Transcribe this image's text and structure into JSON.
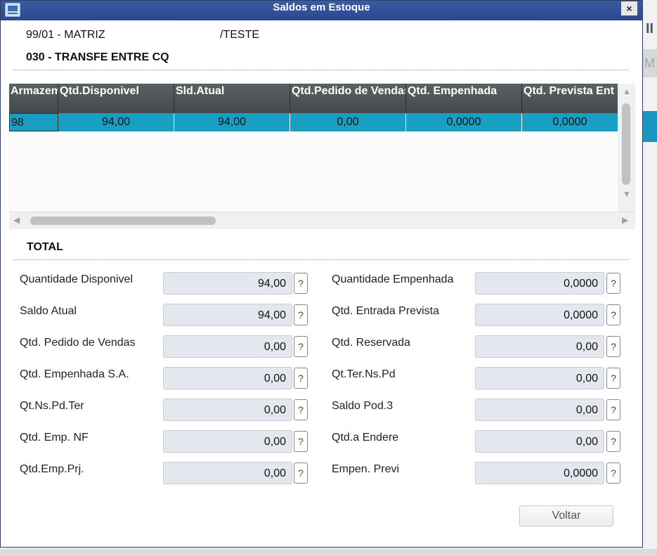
{
  "window": {
    "title": "Saldos em Estoque",
    "close_glyph": "×"
  },
  "background": {
    "right_top": "II",
    "right_mid": "M"
  },
  "header": {
    "branch": "99/01 - MATRIZ",
    "branch_suffix": "/TESTE",
    "product": "030 - TRANSFE ENTRE CQ"
  },
  "grid": {
    "columns": [
      "Armazem",
      "Qtd.Disponivel",
      "Sld.Atual",
      "Qtd.Pedido de Vendas",
      "Qtd. Empenhada",
      "Qtd. Prevista Ent"
    ],
    "rows": [
      [
        "98",
        "94,00",
        "94,00",
        "0,00",
        "0,0000",
        "0,0000"
      ]
    ]
  },
  "total": {
    "label": "TOTAL",
    "help_glyph": "?",
    "left": [
      {
        "label": "Quantidade Disponivel",
        "value": "94,00"
      },
      {
        "label": "Saldo Atual",
        "value": "94,00"
      },
      {
        "label": "Qtd. Pedido de Vendas",
        "value": "0,00"
      },
      {
        "label": "Qtd. Empenhada S.A.",
        "value": "0,00"
      },
      {
        "label": "Qt.Ns.Pd.Ter",
        "value": "0,00"
      },
      {
        "label": "Qtd. Emp. NF",
        "value": "0,00"
      },
      {
        "label": "Qtd.Emp.Prj.",
        "value": "0,00"
      }
    ],
    "right": [
      {
        "label": "Quantidade Empenhada",
        "value": "0,0000"
      },
      {
        "label": "Qtd. Entrada Prevista",
        "value": "0,0000"
      },
      {
        "label": "Qtd. Reservada",
        "value": "0,00"
      },
      {
        "label": "Qt.Ter.Ns.Pd",
        "value": "0,00"
      },
      {
        "label": "Saldo Pod.3",
        "value": "0,00"
      },
      {
        "label": "Qtd.a Endere",
        "value": "0,00"
      },
      {
        "label": "Empen. Previ",
        "value": "0,0000"
      }
    ]
  },
  "actions": {
    "voltar_label": "Voltar"
  },
  "colors": {
    "titlebar": "#2a4890",
    "selected_row": "#1a9fc4",
    "grid_header": "#4b5153"
  }
}
